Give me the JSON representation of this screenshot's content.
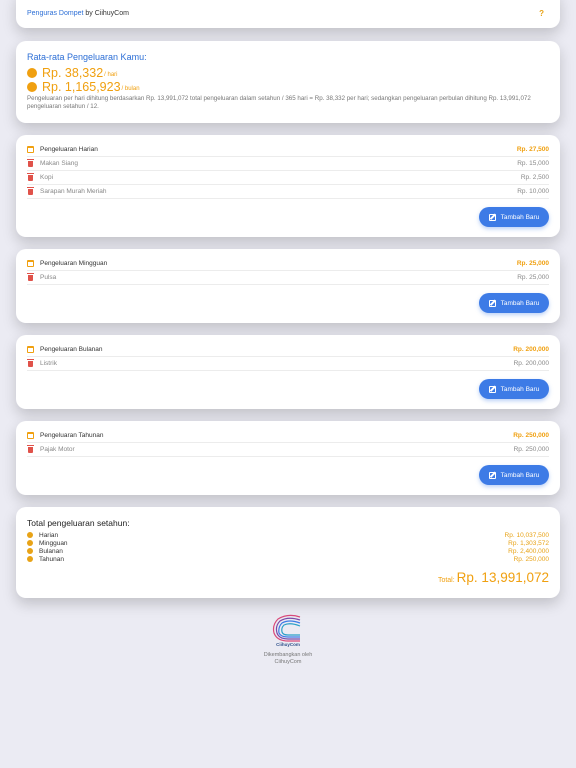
{
  "header": {
    "app_name": "Penguras Dompet",
    "by_text": "by CiihuyCom",
    "help": "?"
  },
  "average": {
    "title": "Rata-rata Pengeluaran Kamu:",
    "daily_value": "Rp. 38,332",
    "daily_unit": "/ hari",
    "monthly_value": "Rp. 1,165,923",
    "monthly_unit": "/ bulan",
    "description": "Pengeluaran per hari dihitung berdasarkan Rp. 13,991,072 total pengeluaran dalam setahun / 365 hari = Rp. 38,332 per hari; sedangkan pengeluaran perbulan dihitung Rp. 13,991,072 pengeluaran setahun / 12."
  },
  "sections": [
    {
      "title": "Pengeluaran Harian",
      "total": "Rp. 27,500",
      "button": "Tambah Baru",
      "items": [
        {
          "name": "Makan Siang",
          "amount": "Rp. 15,000"
        },
        {
          "name": "Kopi",
          "amount": "Rp. 2,500"
        },
        {
          "name": "Sarapan Murah Meriah",
          "amount": "Rp. 10,000"
        }
      ]
    },
    {
      "title": "Pengeluaran Mingguan",
      "total": "Rp. 25,000",
      "button": "Tambah Baru",
      "items": [
        {
          "name": "Pulsa",
          "amount": "Rp. 25,000"
        }
      ]
    },
    {
      "title": "Pengeluaran Bulanan",
      "total": "Rp. 200,000",
      "button": "Tambah Baru",
      "items": [
        {
          "name": "Listrik",
          "amount": "Rp. 200,000"
        }
      ]
    },
    {
      "title": "Pengeluaran Tahunan",
      "total": "Rp. 250,000",
      "button": "Tambah Baru",
      "items": [
        {
          "name": "Pajak Motor",
          "amount": "Rp. 250,000"
        }
      ]
    }
  ],
  "total": {
    "title": "Total pengeluaran setahun:",
    "lines": [
      {
        "label": "Harian",
        "amount": "Rp. 10,037,500"
      },
      {
        "label": "Mingguan",
        "amount": "Rp. 1,303,572"
      },
      {
        "label": "Bulanan",
        "amount": "Rp. 2,400,000"
      },
      {
        "label": "Tahunan",
        "amount": "Rp. 250,000"
      }
    ],
    "grand_label": "Total:",
    "grand_value": "Rp. 13,991,072"
  },
  "footer": {
    "logo_text": "CiihuyCom",
    "line1": "Dikembangkan oleh",
    "line2": "CiihuyCom"
  },
  "colors": {
    "accent": "#f0a010",
    "primary": "#3d7be6",
    "link": "#2d6fd6",
    "danger": "#e0524a"
  }
}
